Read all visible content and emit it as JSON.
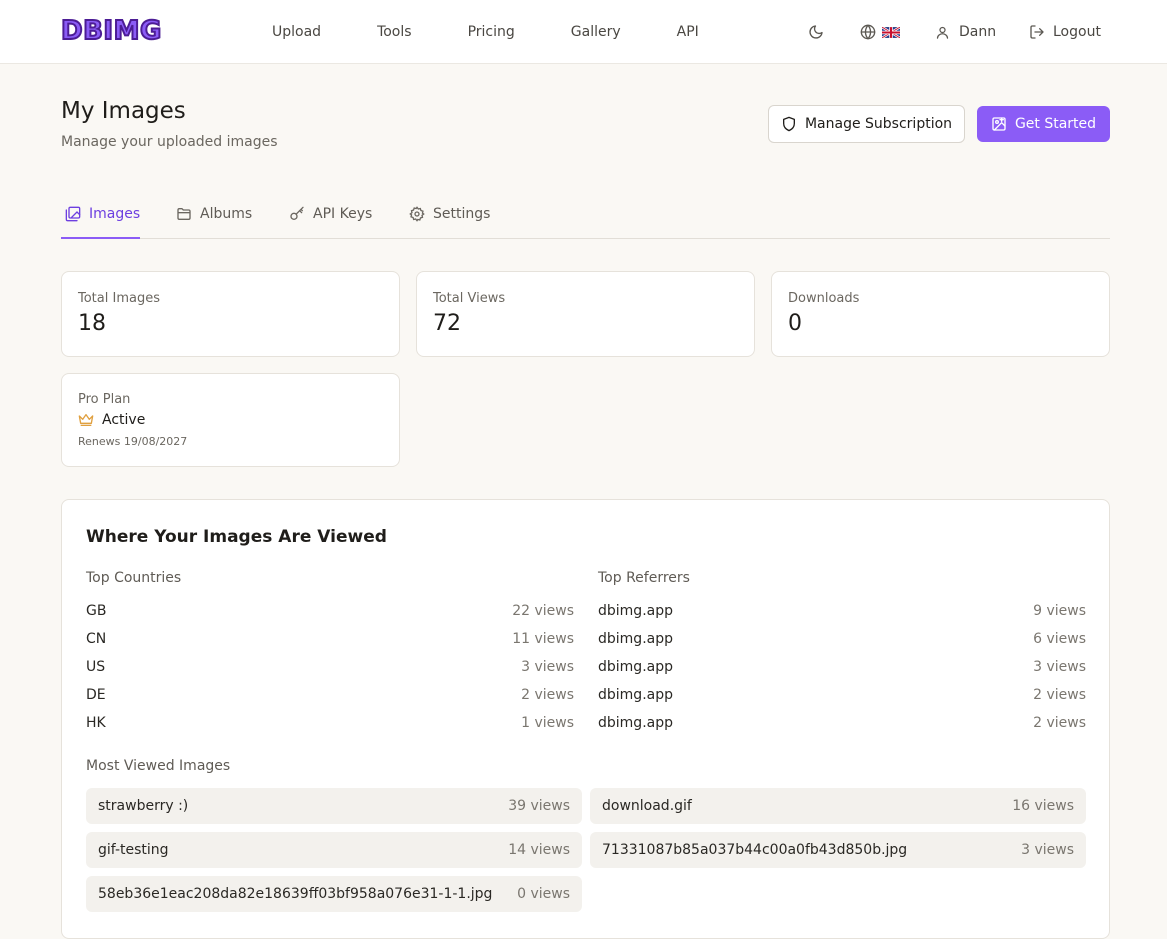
{
  "header": {
    "logo_text": "DBIMG",
    "nav": [
      "Upload",
      "Tools",
      "Pricing",
      "Gallery",
      "API"
    ],
    "user_name": "Dann",
    "logout_label": "Logout",
    "icons": {
      "theme": "moon-icon",
      "language": "globe-icon",
      "flag": "uk-flag-icon",
      "user": "user-icon",
      "logout": "logout-icon"
    }
  },
  "page": {
    "title": "My Images",
    "subtitle": "Manage your uploaded images",
    "manage_subscription_label": "Manage Subscription",
    "get_started_label": "Get Started"
  },
  "tabs": [
    {
      "label": "Images",
      "icon": "images-icon",
      "active": true
    },
    {
      "label": "Albums",
      "icon": "folder-icon",
      "active": false
    },
    {
      "label": "API Keys",
      "icon": "key-icon",
      "active": false
    },
    {
      "label": "Settings",
      "icon": "gear-icon",
      "active": false
    }
  ],
  "stats": [
    {
      "label": "Total Images",
      "value": "18"
    },
    {
      "label": "Total Views",
      "value": "72"
    },
    {
      "label": "Downloads",
      "value": "0"
    }
  ],
  "plan": {
    "label": "Pro Plan",
    "status": "Active",
    "renews": "Renews 19/08/2027"
  },
  "analytics": {
    "title": "Where Your Images Are Viewed",
    "countries_label": "Top Countries",
    "countries": [
      {
        "name": "GB",
        "views": "22 views"
      },
      {
        "name": "CN",
        "views": "11 views"
      },
      {
        "name": "US",
        "views": "3 views"
      },
      {
        "name": "DE",
        "views": "2 views"
      },
      {
        "name": "HK",
        "views": "1 views"
      }
    ],
    "referrers_label": "Top Referrers",
    "referrers": [
      {
        "name": "dbimg.app",
        "views": "9 views"
      },
      {
        "name": "dbimg.app",
        "views": "6 views"
      },
      {
        "name": "dbimg.app",
        "views": "3 views"
      },
      {
        "name": "dbimg.app",
        "views": "2 views"
      },
      {
        "name": "dbimg.app",
        "views": "2 views"
      }
    ],
    "most_viewed_label": "Most Viewed Images",
    "most_viewed": [
      {
        "name": "strawberry :)",
        "views": "39 views"
      },
      {
        "name": "download.gif",
        "views": "16 views"
      },
      {
        "name": "gif-testing",
        "views": "14 views"
      },
      {
        "name": "71331087b85a037b44c00a0fb43d850b.jpg",
        "views": "3 views"
      },
      {
        "name": "58eb36e1eac208da82e18639ff03bf958a076e31-1-1.jpg",
        "views": "0 views"
      }
    ]
  },
  "colors": {
    "accent": "#8b5cf6",
    "background": "#faf8f4",
    "crown": "#e0a040"
  }
}
